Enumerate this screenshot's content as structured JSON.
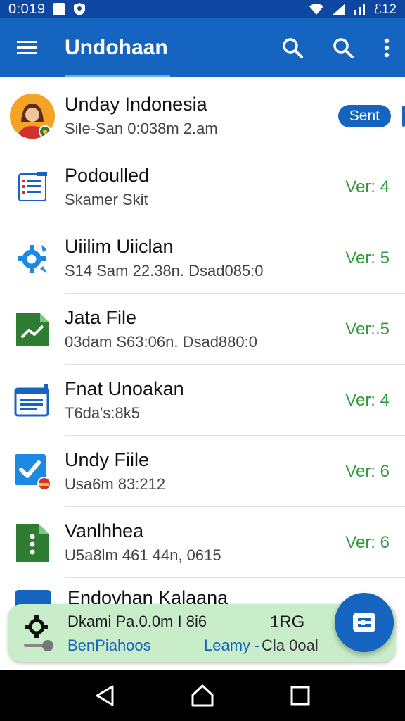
{
  "status_bar": {
    "time": "0:019",
    "right_text": "ℰ12"
  },
  "app_bar": {
    "title": "Undohaan",
    "icons": [
      "menu-icon",
      "search-icon",
      "search-icon",
      "more-vert-icon"
    ]
  },
  "list": {
    "items": [
      {
        "title": "Unday Indonesia",
        "subtitle": "Sile-San 0:038m 2.am",
        "badge": "Sent",
        "icon": "avatar"
      },
      {
        "title": "Podoulled",
        "subtitle": "Skamer Skit",
        "version": "Ver: 4",
        "icon": "document-list-icon"
      },
      {
        "title": "Uiilim Uiiclan",
        "subtitle": "S14 Sam  22.38n. Dsad085:0",
        "version": "Ver: 5",
        "icon": "gear-icon"
      },
      {
        "title": "Jata File",
        "subtitle": "03dam S63:06n. Dsad880:0",
        "version": "Ver:.5",
        "icon": "chart-file-icon"
      },
      {
        "title": "Fnat Unoakan",
        "subtitle": "T6da's:8k5",
        "version": "Ver: 4",
        "icon": "form-icon"
      },
      {
        "title": "Undy Fiile",
        "subtitle": "Usa6m 83:212",
        "version": "Ver: 6",
        "icon": "check-file-icon"
      },
      {
        "title": "Vanlhhea",
        "subtitle": "U5a8lm 461 44n, 0615",
        "version": "Ver: 6",
        "icon": "green-file-icon"
      }
    ],
    "partial_item": {
      "title": "Endovhan Kalaana"
    }
  },
  "bottom_sheet": {
    "line1": "Dkami  Pa.0.0m I 8i6",
    "line1_right": "1RG",
    "link1": "BenPiahoos",
    "link2": "Leamy -",
    "link3": "Cla 0oal"
  },
  "colors": {
    "primary": "#1565c0",
    "status_bar": "#0d47a1",
    "version_green": "#2e9c3b",
    "sheet_bg": "#c9ecc9"
  }
}
